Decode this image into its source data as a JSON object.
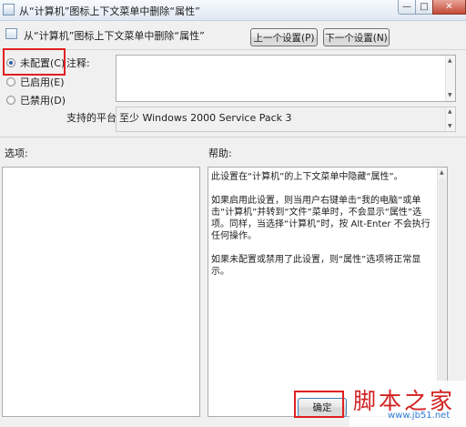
{
  "window": {
    "title": "从“计算机”图标上下文菜单中删除“属性”",
    "controls": {
      "minimize": "—",
      "maximize": "□",
      "close": "✕"
    }
  },
  "dialog": {
    "heading": "从“计算机”图标上下文菜单中删除“属性”",
    "prev_button": "上一个设置(P)",
    "next_button": "下一个设置(N)"
  },
  "radios": [
    {
      "label": "未配置(C)",
      "selected": true
    },
    {
      "label": "已启用(E)",
      "selected": false
    },
    {
      "label": "已禁用(D)",
      "selected": false
    }
  ],
  "comment": {
    "label": "注释:",
    "value": ""
  },
  "platform": {
    "label": "支持的平台:",
    "value": "至少 Windows 2000 Service Pack 3"
  },
  "options": {
    "label": "选项:"
  },
  "help": {
    "label": "帮助:",
    "paragraphs": [
      "此设置在“计算机”的上下文菜单中隐藏“属性”。",
      "如果启用此设置，则当用户右键单击“我的电脑”或单击“计算机”并转到“文件”菜单时，不会显示“属性”选项。同样，当选择“计算机”时，按 Alt-Enter 不会执行任何操作。",
      "如果未配置或禁用了此设置，则“属性”选项将正常显示。"
    ]
  },
  "footer": {
    "ok_button": "确定"
  },
  "watermark": {
    "main": "脚本之家",
    "sub": "www.jb51.net"
  },
  "colors": {
    "highlight": "#e02020",
    "watermark_red": "#d22121",
    "watermark_blue": "#2e7dd6"
  }
}
